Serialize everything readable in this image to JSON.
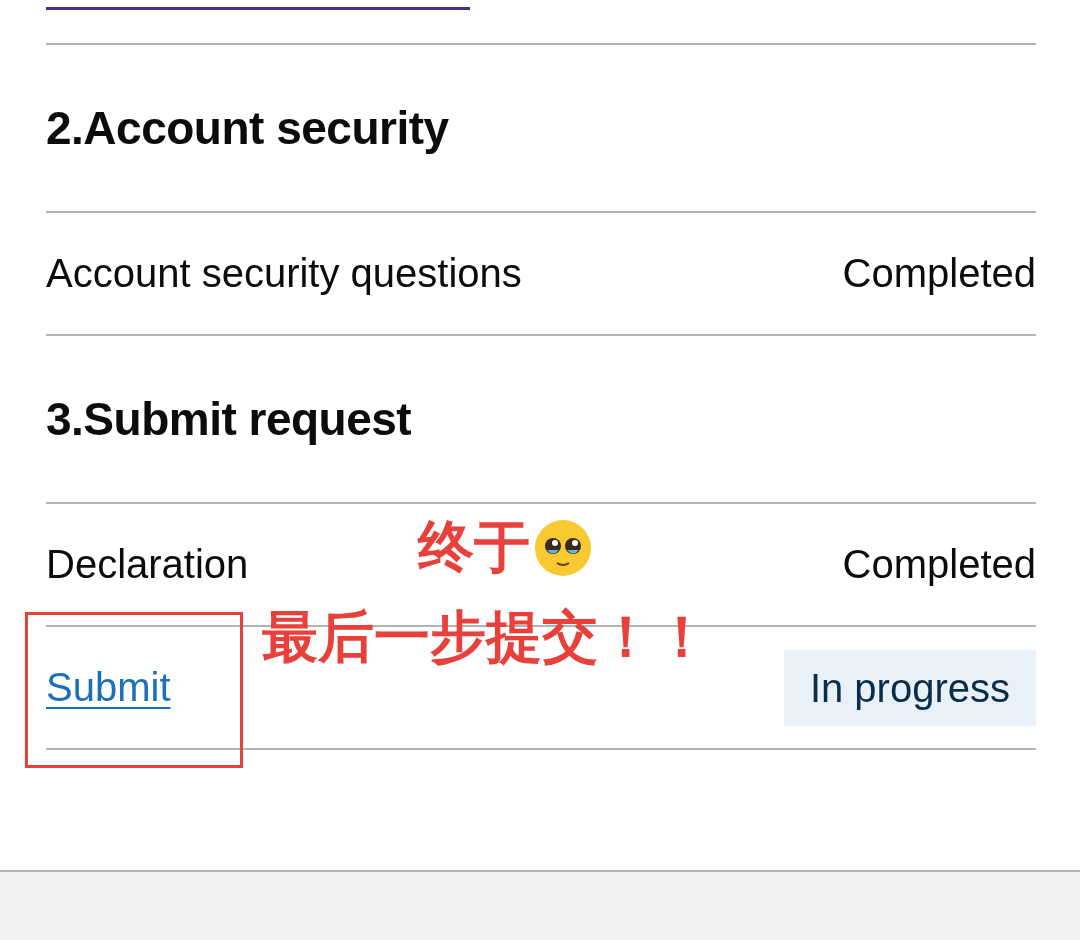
{
  "sections": [
    {
      "heading": "2.Account security",
      "tasks": [
        {
          "label": "Account security questions",
          "kind": "text",
          "status": "Completed",
          "status_tagged": false
        }
      ]
    },
    {
      "heading": "3.Submit request",
      "tasks": [
        {
          "label": "Declaration",
          "kind": "text",
          "status": "Completed",
          "status_tagged": false
        },
        {
          "label": "Submit",
          "kind": "link",
          "status": "In progress",
          "status_tagged": true
        }
      ]
    }
  ],
  "annotation": {
    "line_1": "终于",
    "line_2": "最后一步提交！！"
  }
}
